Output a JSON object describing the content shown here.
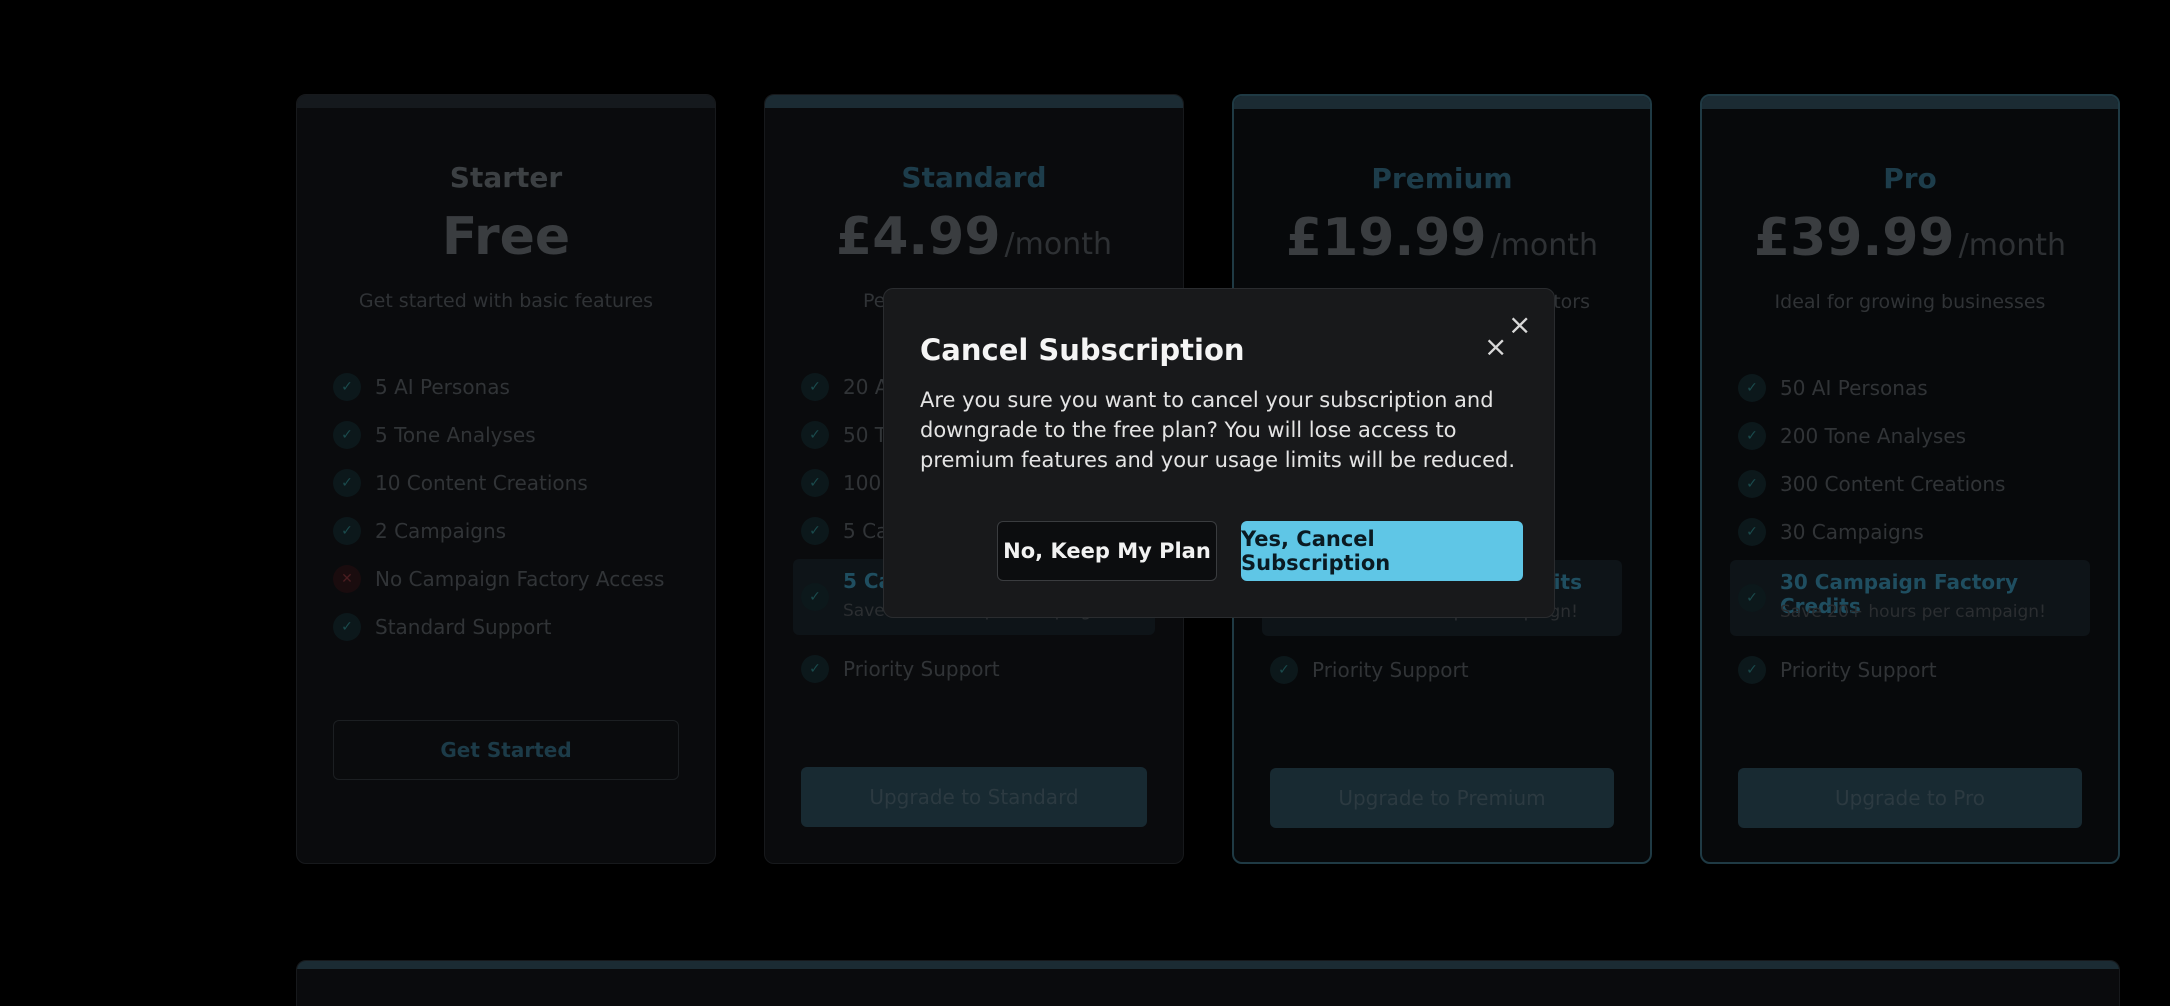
{
  "plans": [
    {
      "name": "Starter",
      "price": "Free",
      "period": "",
      "description": "Get started with basic features",
      "features": [
        {
          "text": "5 AI Personas",
          "included": true
        },
        {
          "text": "5 Tone Analyses",
          "included": true
        },
        {
          "text": "10 Content Creations",
          "included": true
        },
        {
          "text": "2 Campaigns",
          "included": true
        },
        {
          "text": "No Campaign Factory Access",
          "included": false
        },
        {
          "text": "Standard Support",
          "included": true
        }
      ],
      "button": "Get Started"
    },
    {
      "name": "Standard",
      "price": "£4.99",
      "period": "/month",
      "description": "Pe",
      "features": [
        {
          "text": "20 A",
          "included": true
        },
        {
          "text": "50 To",
          "included": true
        },
        {
          "text": "100",
          "included": true
        },
        {
          "text": "5 Ca",
          "included": true
        }
      ],
      "credits": {
        "title": "5 Ca",
        "subtitle": "Save 20+ hours per campaign!"
      },
      "support": "Priority Support",
      "button": "Upgrade to Standard"
    },
    {
      "name": "Premium",
      "price": "£19.99",
      "period": "/month",
      "description": "tors",
      "credits": {
        "title": "dits",
        "subtitle": "Save 20+ hours per campaign!"
      },
      "support": "Priority Support",
      "button": "Upgrade to Premium"
    },
    {
      "name": "Pro",
      "price": "£39.99",
      "period": "/month",
      "description": "Ideal for growing businesses",
      "features": [
        {
          "text": "50 AI Personas",
          "included": true
        },
        {
          "text": "200 Tone Analyses",
          "included": true
        },
        {
          "text": "300 Content Creations",
          "included": true
        },
        {
          "text": "30 Campaigns",
          "included": true
        }
      ],
      "credits": {
        "title": "30 Campaign Factory Credits",
        "subtitle": "Save 20+ hours per campaign!"
      },
      "support": "Priority Support",
      "button": "Upgrade to Pro"
    }
  ],
  "modal": {
    "title": "Cancel Subscription",
    "body": "Are you sure you want to cancel your subscription and downgrade to the free plan? You will lose access to premium features and your usage limits will be reduced.",
    "keep_button": "No, Keep My Plan",
    "confirm_button": "Yes, Cancel Subscription",
    "close_icon": "close-icon"
  },
  "colors": {
    "accent": "#5fc6e6",
    "modal_bg": "#18191b",
    "page_bg": "#000000"
  }
}
